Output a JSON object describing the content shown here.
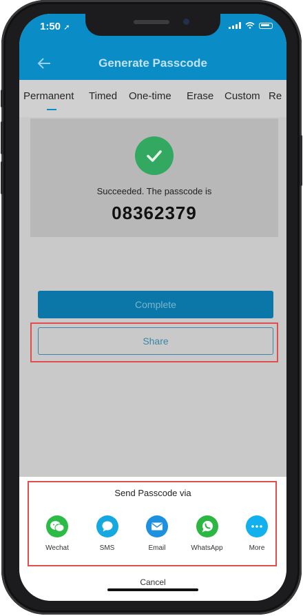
{
  "status_bar": {
    "time": "1:50"
  },
  "nav": {
    "title": "Generate Passcode"
  },
  "tabs": [
    {
      "label": "Permanent"
    },
    {
      "label": "Timed"
    },
    {
      "label": "One-time"
    },
    {
      "label": "Erase"
    },
    {
      "label": "Custom"
    },
    {
      "label": "Re"
    }
  ],
  "result": {
    "message": "Succeeded. The passcode is",
    "passcode": "08362379"
  },
  "buttons": {
    "complete": "Complete",
    "share": "Share"
  },
  "share_sheet": {
    "title": "Send Passcode via",
    "options": [
      {
        "label": "Wechat",
        "icon": "wechat-icon",
        "color": "#2dbb47"
      },
      {
        "label": "SMS",
        "icon": "sms-icon",
        "color": "#16a8e0"
      },
      {
        "label": "Email",
        "icon": "email-icon",
        "color": "#1e90e0"
      },
      {
        "label": "WhatsApp",
        "icon": "whatsapp-icon",
        "color": "#2cb742"
      },
      {
        "label": "More",
        "icon": "more-icon",
        "color": "#12b0ec"
      }
    ],
    "cancel": "Cancel"
  },
  "colors": {
    "header": "#0a8dc7",
    "highlight": "#e04d4d",
    "success": "#32a860"
  }
}
